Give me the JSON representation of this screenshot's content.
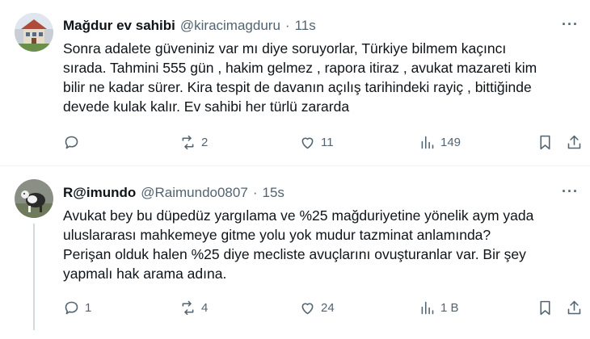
{
  "tweets": [
    {
      "name": "Mağdur ev sahibi",
      "handle": "@kiracimagduru",
      "dot": "·",
      "time": "11s",
      "more": "···",
      "lines": [
        "Sonra adalete güveniniz var mı diye soruyorlar, Türkiye bilmem kaçıncı",
        "sırada. Tahmini 555 gün , hakim gelmez , rapora itiraz , avukat mazareti kim",
        "bilir ne kadar sürer. Kira tespit de davanın açılış tarihindeki rayiç , bittiğinde",
        "devede kulak kalır. Ev sahibi her türlü zararda"
      ],
      "actions": {
        "replies": "",
        "reposts": "2",
        "likes": "11",
        "views": "149"
      },
      "icons": [
        "reply-icon",
        "repost-icon",
        "like-icon",
        "views-icon",
        "bookmark-icon",
        "share-icon"
      ]
    },
    {
      "name": "R@imundo",
      "handle": "@Raimundo0807",
      "dot": "·",
      "time": "15s",
      "more": "···",
      "lines": [
        "Avukat bey bu düpedüz yargılama ve %25 mağduriyetine yönelik aym yada",
        "uluslararası mahkemeye gitme yolu yok mudur tazminat anlamında?",
        "Perişan olduk halen %25 diye mecliste avuçlarını ovuşturanlar var. Bir şey",
        "yapmalı hak arama adına."
      ],
      "actions": {
        "replies": "1",
        "reposts": "4",
        "likes": "24",
        "views": "1 B"
      },
      "icons": [
        "reply-icon",
        "repost-icon",
        "like-icon",
        "views-icon",
        "bookmark-icon",
        "share-icon"
      ]
    }
  ],
  "colors": {
    "text": "#0f1419",
    "muted": "#536471",
    "divider": "#eff3f4",
    "thread_line": "#cfd9de"
  }
}
